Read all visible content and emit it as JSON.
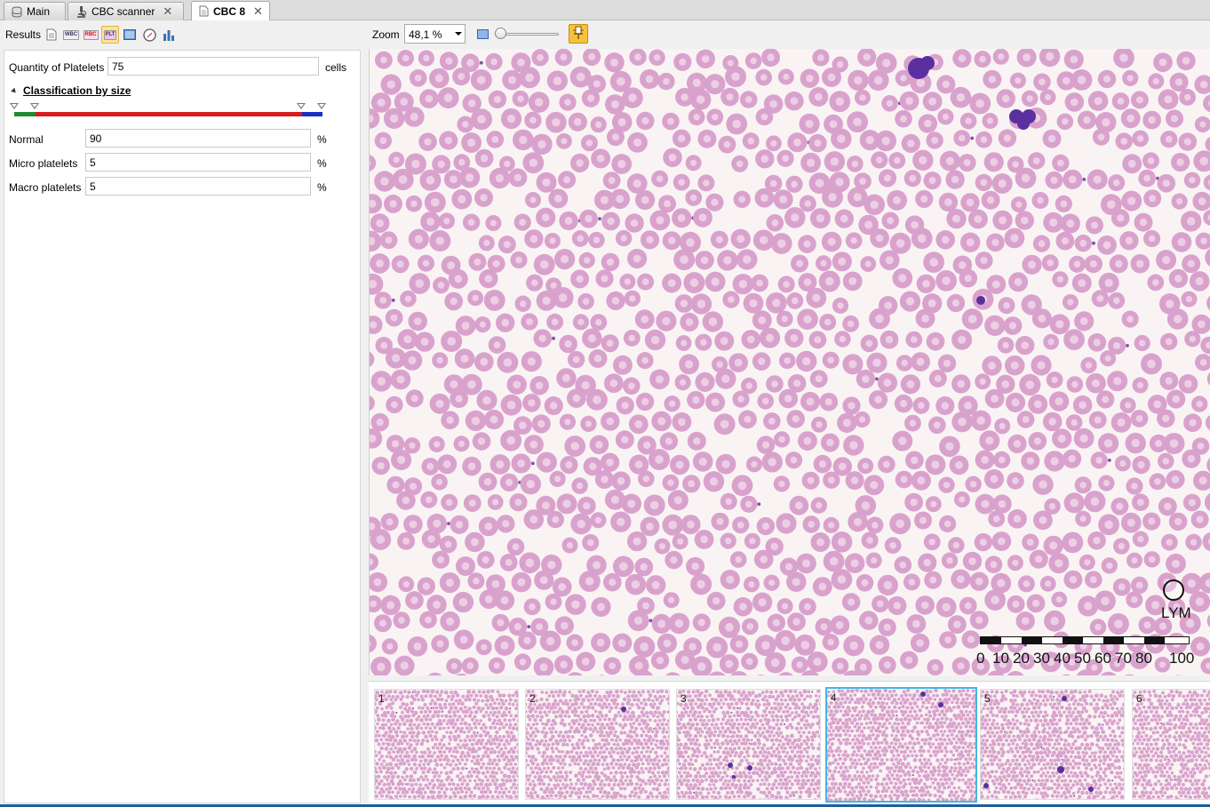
{
  "tabs": [
    {
      "label": "Main",
      "icon": "database-icon",
      "closable": false,
      "active": false
    },
    {
      "label": "CBC scanner",
      "icon": "microscope-icon",
      "closable": true,
      "active": false
    },
    {
      "label": "CBC 8",
      "icon": "document-icon",
      "closable": true,
      "active": true
    }
  ],
  "toolbar": {
    "results_label": "Results",
    "icons": [
      "report-icon",
      "wbc-icon",
      "rbc-icon",
      "plt-icon",
      "image-icon",
      "compass-icon",
      "bar-chart-icon"
    ],
    "selected_icon": "plt-icon",
    "wbc_text": "WBC",
    "rbc_text": "RBC",
    "plt_text": "PLT",
    "zoom_label": "Zoom",
    "zoom_value": "48,1 %",
    "zoom_level_fraction": 0.05
  },
  "platelets": {
    "quantity_label": "Quantity of Platelets",
    "quantity_value": "75",
    "quantity_unit": "cells",
    "classification_title": "Classification by size",
    "size_bands": [
      {
        "name": "micro",
        "color": "#1e8c2e"
      },
      {
        "name": "normal",
        "color": "#d71d1d"
      },
      {
        "name": "macro",
        "color": "#1a2fc4"
      }
    ],
    "rows": [
      {
        "label": "Normal",
        "value": "90",
        "unit": "%"
      },
      {
        "label": "Micro platelets",
        "value": "5",
        "unit": "%"
      },
      {
        "label": "Macro platelets",
        "value": "5",
        "unit": "%"
      }
    ]
  },
  "viewer": {
    "marker_label": "LYM",
    "scale_labels": [
      "0",
      "10",
      "20",
      "30",
      "40",
      "50",
      "60",
      "70",
      "80",
      "100"
    ]
  },
  "thumbnails": [
    {
      "number": "1",
      "selected": false
    },
    {
      "number": "2",
      "selected": false
    },
    {
      "number": "3",
      "selected": false
    },
    {
      "number": "4",
      "selected": true
    },
    {
      "number": "5",
      "selected": false
    },
    {
      "number": "6",
      "selected": false
    }
  ],
  "colors": {
    "accent_selected": "#43b6e3",
    "rbc_fill": "#d9a2cd",
    "rbc_center": "#f1dbeb",
    "wbc_nucleus": "#5a2f9e",
    "plt_highlight": "#fbe39c"
  }
}
